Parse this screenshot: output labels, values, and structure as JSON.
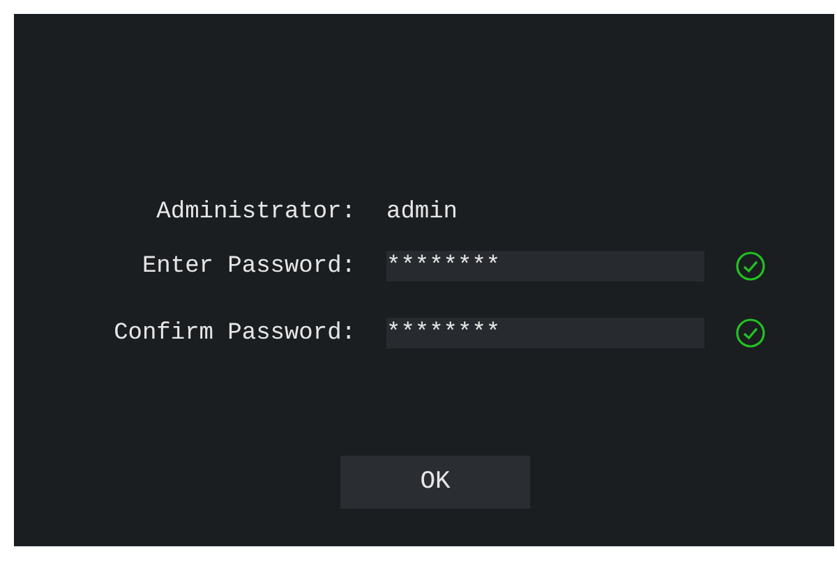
{
  "administrator": {
    "label": "Administrator:",
    "value": "admin"
  },
  "fields": [
    {
      "label": "Enter Password:",
      "value": "********",
      "valid": true
    },
    {
      "label": "Confirm Password:",
      "value": "********",
      "valid": true
    }
  ],
  "button": "OK"
}
